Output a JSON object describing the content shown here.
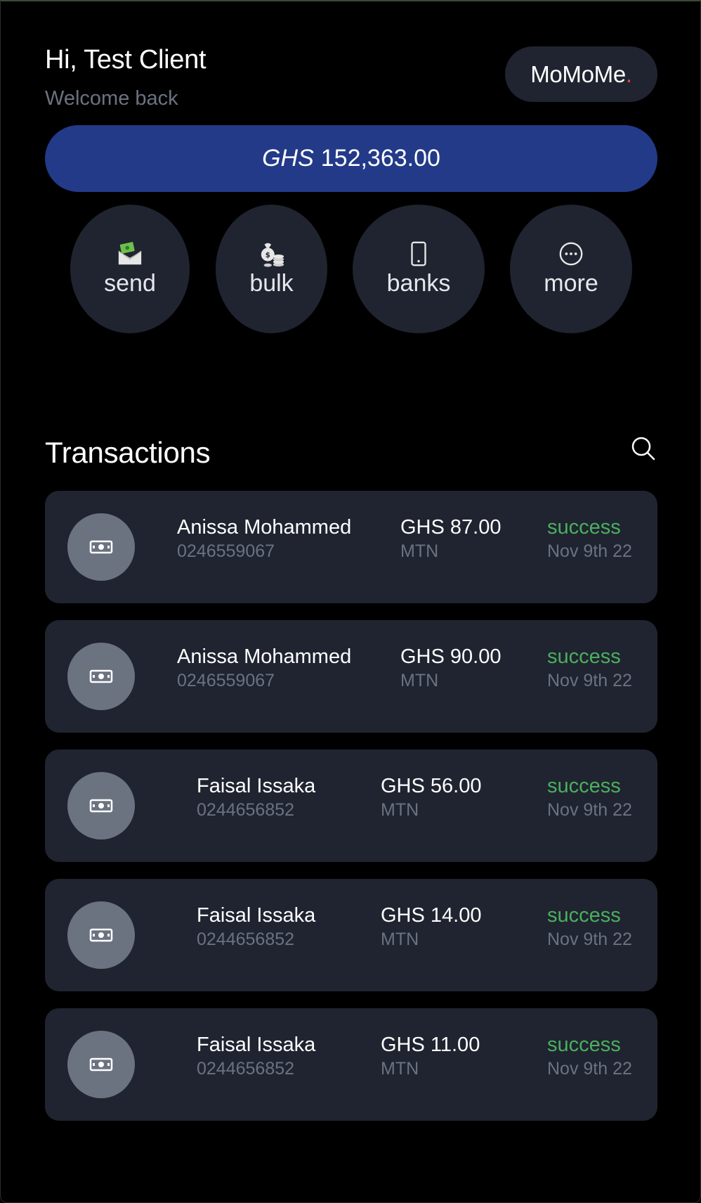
{
  "header": {
    "greeting": "Hi, Test Client",
    "subtitle": "Welcome back",
    "brand_name": "MoMoMe",
    "brand_dot": ".",
    "brand_dot_color": "#e0483e"
  },
  "balance": {
    "currency": "GHS",
    "amount": "152,363.00",
    "bg_color": "#233a88"
  },
  "actions": [
    {
      "label": "send",
      "icon": "money-envelope-icon"
    },
    {
      "label": "bulk",
      "icon": "money-bag-coins-icon"
    },
    {
      "label": "banks",
      "icon": "mobile-phone-icon"
    },
    {
      "label": "more",
      "icon": "more-dots-icon"
    }
  ],
  "transactions_section": {
    "title": "Transactions",
    "search_icon": "search-icon"
  },
  "transactions": [
    {
      "name": "Anissa Mohammed",
      "phone": "0246559067",
      "amount": "GHS 87.00",
      "network": "MTN",
      "status": "success",
      "date": "Nov 9th 22",
      "icon": "cash-icon"
    },
    {
      "name": "Anissa Mohammed",
      "phone": "0246559067",
      "amount": "GHS 90.00",
      "network": "MTN",
      "status": "success",
      "date": "Nov 9th 22",
      "icon": "cash-icon"
    },
    {
      "name": "Faisal Issaka",
      "phone": "0244656852",
      "amount": "GHS 56.00",
      "network": "MTN",
      "status": "success",
      "date": "Nov 9th 22",
      "icon": "cash-icon"
    },
    {
      "name": "Faisal Issaka",
      "phone": "0244656852",
      "amount": "GHS 14.00",
      "network": "MTN",
      "status": "success",
      "date": "Nov 9th 22",
      "icon": "cash-icon"
    },
    {
      "name": "Faisal Issaka",
      "phone": "0244656852",
      "amount": "GHS 11.00",
      "network": "MTN",
      "status": "success",
      "date": "Nov 9th 22",
      "icon": "cash-icon"
    }
  ],
  "colors": {
    "background": "#000000",
    "card": "#1f2430",
    "muted": "#6b7280",
    "success": "#4caf5f"
  }
}
